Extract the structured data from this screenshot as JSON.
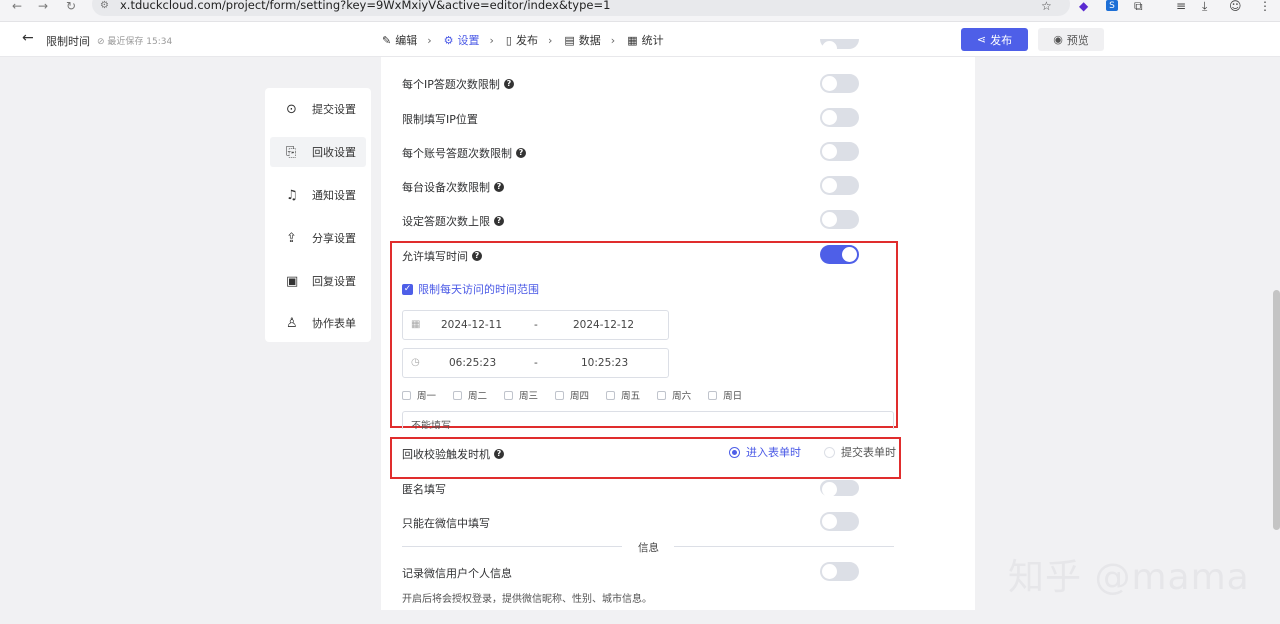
{
  "browser": {
    "url": "x.tduckcloud.com/project/form/setting?key=9WxMxiyV&active=editor/index&type=1"
  },
  "header": {
    "back_icon": "arrow-left-icon",
    "title": "限制时间",
    "save_status": "最近保存 15:34",
    "steps": [
      {
        "label": "编辑",
        "icon": "edit-icon"
      },
      {
        "label": "设置",
        "icon": "gear-icon",
        "active": true
      },
      {
        "label": "发布",
        "icon": "publish-icon"
      },
      {
        "label": "数据",
        "icon": "data-icon"
      },
      {
        "label": "统计",
        "icon": "stats-icon"
      }
    ],
    "publish_label": "发布",
    "preview_label": "预览"
  },
  "sidebar": {
    "items": [
      {
        "label": "提交设置",
        "icon": "check-circle-icon"
      },
      {
        "label": "回收设置",
        "icon": "recycle-icon",
        "active": true
      },
      {
        "label": "通知设置",
        "icon": "bell-icon"
      },
      {
        "label": "分享设置",
        "icon": "share-icon"
      },
      {
        "label": "回复设置",
        "icon": "reply-icon"
      },
      {
        "label": "协作表单",
        "icon": "users-icon"
      }
    ]
  },
  "settings": {
    "ip_limit": "每个IP答题次数限制",
    "ip_location": "限制填写IP位置",
    "account_limit": "每个账号答题次数限制",
    "device_limit": "每台设备次数限制",
    "max_answers": "设定答题次数上限",
    "allow_time": "允许填写时间",
    "daily_range": "限制每天访问的时间范围",
    "date_start": "2024-12-11",
    "date_end": "2024-12-12",
    "time_start": "06:25:23",
    "time_end": "10:25:23",
    "range_sep": "-",
    "weekdays": [
      "周一",
      "周二",
      "周三",
      "周四",
      "周五",
      "周六",
      "周日"
    ],
    "cannot_fill": "不能填写",
    "trigger_label": "回收校验触发时机",
    "trigger_options": [
      "进入表单时",
      "提交表单时"
    ],
    "anonymous": "匿名填写",
    "wechat_only": "只能在微信中填写",
    "info_divider": "信息",
    "record_wechat": "记录微信用户个人信息",
    "record_desc": "开启后将会授权登录，提供微信昵称、性别、城市信息。"
  },
  "watermark": "知乎 @mama",
  "colors": {
    "primary": "#4e5fe8",
    "highlight_box": "#e02d2d"
  }
}
